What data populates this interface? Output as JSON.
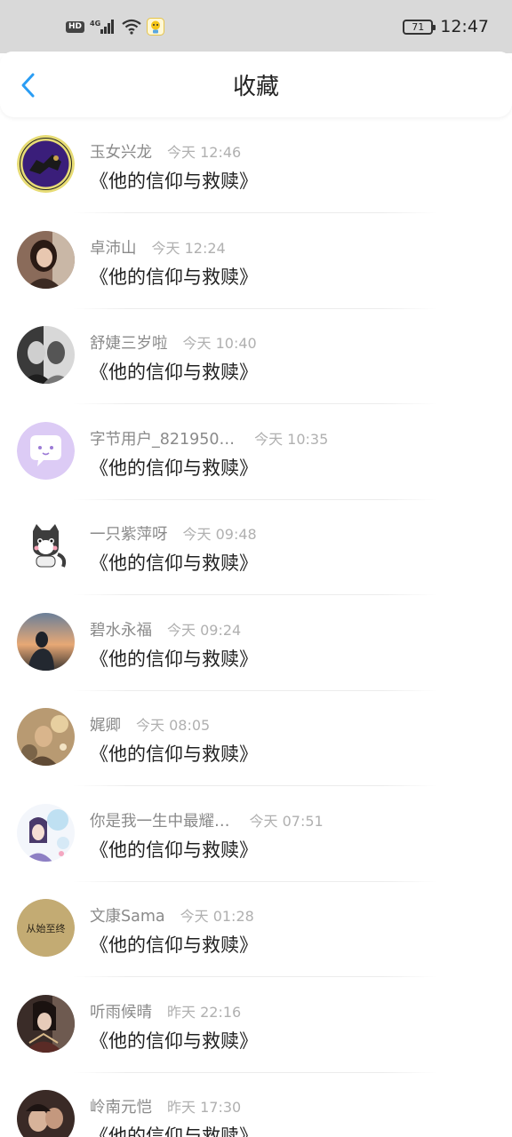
{
  "status_bar": {
    "hd": "HD",
    "network": "4G",
    "battery": "71",
    "time": "12:47"
  },
  "header": {
    "title": "收藏",
    "back_icon": "chevron-left-icon",
    "accent": "#2a9df4"
  },
  "favorites": [
    {
      "user": "玉女兴龙",
      "time": "今天 12:46",
      "title": "《他的信仰与救赎》"
    },
    {
      "user": "卓沛山",
      "time": "今天 12:24",
      "title": "《他的信仰与救赎》"
    },
    {
      "user": "舒婕三岁啦",
      "time": "今天 10:40",
      "title": "《他的信仰与救赎》"
    },
    {
      "user": "字节用户_821950…",
      "time": "今天 10:35",
      "title": "《他的信仰与救赎》"
    },
    {
      "user": "一只紫萍呀",
      "time": "今天 09:48",
      "title": "《他的信仰与救赎》"
    },
    {
      "user": "碧水永福",
      "time": "今天 09:24",
      "title": "《他的信仰与救赎》"
    },
    {
      "user": "娓卿",
      "time": "今天 08:05",
      "title": "《他的信仰与救赎》"
    },
    {
      "user": "你是我一生中最耀…",
      "time": "今天 07:51",
      "title": "《他的信仰与救赎》"
    },
    {
      "user": "文康Sama",
      "time": "今天 01:28",
      "title": "《他的信仰与救赎》",
      "avatar_text": "从始至终"
    },
    {
      "user": "听雨候晴",
      "time": "昨天 22:16",
      "title": "《他的信仰与救赎》"
    },
    {
      "user": "岭南元恺",
      "time": "昨天 17:30",
      "title": "《他的信仰与救赎》"
    }
  ]
}
